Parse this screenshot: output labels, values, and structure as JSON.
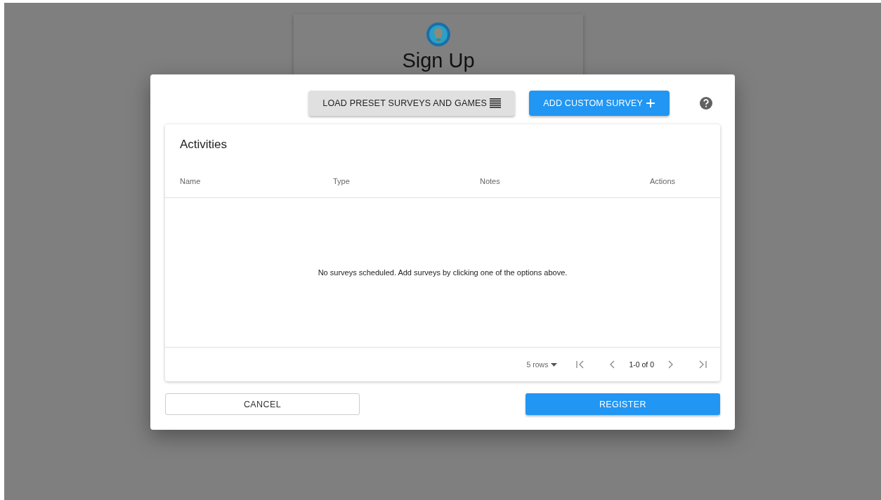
{
  "background_page": {
    "title": "Sign Up"
  },
  "dialog": {
    "toolbar": {
      "buttons": [
        {
          "label": "LOAD PRESET SURVEYS AND GAMES",
          "kind": "secondary"
        },
        {
          "label": "ADD CUSTOM SURVEY",
          "kind": "primary"
        }
      ]
    },
    "table": {
      "title": "Activities",
      "columns": [
        "Name",
        "Type",
        "Notes",
        "Actions"
      ],
      "empty_message": "No surveys scheduled. Add surveys by clicking one of the options above.",
      "pagination": {
        "rows_per_page": "5 rows",
        "range": "1-0 of 0"
      }
    },
    "actions": [
      {
        "label": "CANCEL",
        "kind": "outlined"
      },
      {
        "label": "REGISTER",
        "kind": "primary"
      }
    ]
  }
}
